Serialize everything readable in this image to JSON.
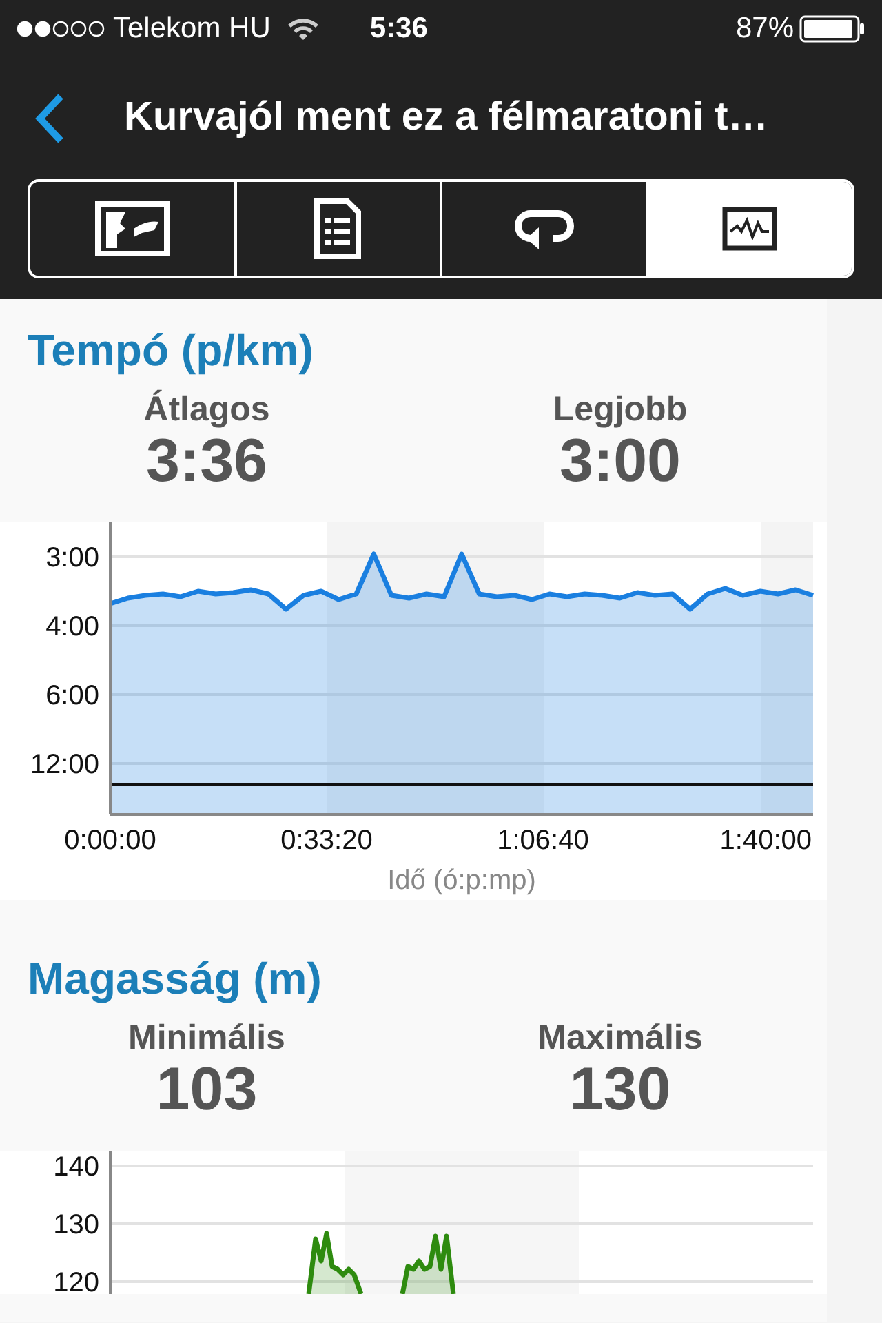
{
  "status_bar": {
    "carrier": "Telekom HU",
    "time": "5:36",
    "battery": "87%"
  },
  "nav": {
    "title": "Kurvajól ment ez a félmaratoni t…"
  },
  "tabs": [
    {
      "kind": "map",
      "selected": false
    },
    {
      "kind": "details",
      "selected": false
    },
    {
      "kind": "laps",
      "selected": false
    },
    {
      "kind": "charts",
      "selected": true
    }
  ],
  "sections": [
    {
      "title": "Tempó (p/km)",
      "stats": [
        {
          "label": "Átlagos",
          "value": "3:36"
        },
        {
          "label": "Legjobb",
          "value": "3:00"
        }
      ],
      "pace_chart": {
        "y_labels": [
          "3:00",
          "4:00",
          "6:00",
          "12:00"
        ],
        "x_labels": [
          "0:00:00",
          "0:33:20",
          "1:06:40",
          "1:40:00"
        ],
        "x_title": "Idő (ó:p:mp)"
      }
    },
    {
      "title": "Magasság (m)",
      "stats": [
        {
          "label": "Minimális",
          "value": "103"
        },
        {
          "label": "Maximális",
          "value": "130"
        }
      ],
      "elevation_chart": {
        "y_labels": [
          "140",
          "130",
          "120"
        ]
      }
    }
  ]
}
